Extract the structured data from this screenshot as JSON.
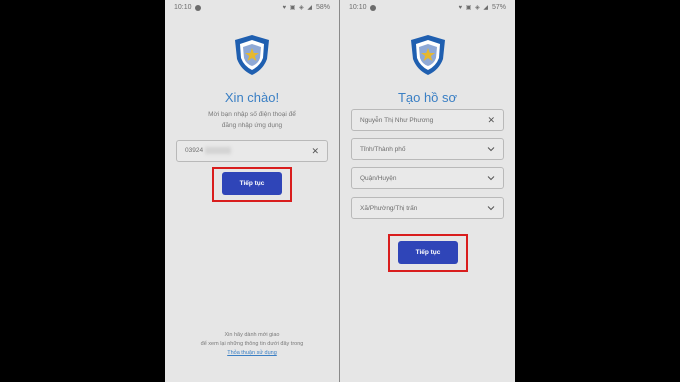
{
  "left_screen": {
    "status": {
      "time": "10:10",
      "battery": "58%"
    },
    "title": "Xin chào!",
    "subtitle_line1": "Mời bạn nhập số điện thoại để",
    "subtitle_line2": "đăng nhập ứng dụng",
    "phone_field": {
      "value": "03924"
    },
    "continue_label": "Tiếp tục",
    "footer_line1": "Xin hãy dành mới giao",
    "footer_line2": "để xem lại những thông tin dưới đây trong",
    "footer_link": "Thỏa thuận sử dụng"
  },
  "right_screen": {
    "status": {
      "time": "10:10",
      "battery": "57%"
    },
    "title": "Tạo hồ sơ",
    "name_field": {
      "value": "Nguyễn Thị Như Phương"
    },
    "province_field": {
      "placeholder": "Tỉnh/Thành phố"
    },
    "district_field": {
      "placeholder": "Quận/Huyện"
    },
    "ward_field": {
      "placeholder": "Xã/Phường/Thị trấn"
    },
    "continue_label": "Tiếp tục"
  },
  "colors": {
    "accent": "#2f45b8",
    "title": "#3a7fc4",
    "highlight": "#d91d1d",
    "shield": "#1f5fb0"
  },
  "icons": [
    "shield-star-logo-icon",
    "clear-icon",
    "chevron-down-icon"
  ]
}
